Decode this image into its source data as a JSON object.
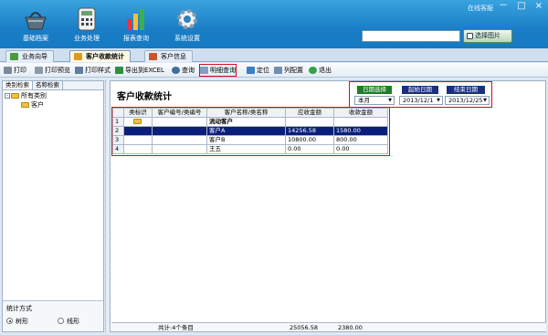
{
  "window": {
    "title": "在线客服",
    "min": "－",
    "max": "□",
    "close": "×"
  },
  "nav": [
    {
      "label": "基础档案",
      "icon": "basket-icon"
    },
    {
      "label": "业务处理",
      "icon": "calculator-icon"
    },
    {
      "label": "报表查询",
      "icon": "bar-chart-icon"
    },
    {
      "label": "系统设置",
      "icon": "gear-icon"
    }
  ],
  "search": {
    "value": "",
    "button": "选择图片"
  },
  "tabs": [
    {
      "label": "业务向导"
    },
    {
      "label": "客户收款统计"
    },
    {
      "label": "客户信息"
    }
  ],
  "toolbar": [
    "打印",
    "打印预览",
    "打印样式",
    "导出到EXCEL",
    "查询",
    "明细查询",
    "定位",
    "列配置",
    "退出"
  ],
  "left": {
    "tabs": [
      "类别检索",
      "名称检索"
    ],
    "tree": {
      "root": "所有类别",
      "child": "客户"
    },
    "stat": {
      "title": "统计方式",
      "opt1": "树形",
      "opt2": "线形"
    }
  },
  "page": {
    "title": "客户收款统计"
  },
  "filter": {
    "h1": "日期选择",
    "h2": "起始日期",
    "h3": "结束日期",
    "v1": "本月",
    "v2": "2013/12/1",
    "v3": "2013/12/25"
  },
  "table": {
    "headers": [
      "",
      "类标识",
      "客户编号/类编号",
      "客户名称/类名称",
      "应收金额",
      "收款金额"
    ],
    "rows": [
      [
        "1",
        "",
        "",
        "流动客户",
        "",
        ""
      ],
      [
        "2",
        "",
        "",
        "客户A",
        "14256.58",
        "1580.00"
      ],
      [
        "3",
        "",
        "",
        "客户B",
        "10800.00",
        "800.00"
      ],
      [
        "4",
        "",
        "",
        "王五",
        "0.00",
        "0.00"
      ]
    ]
  },
  "footer": {
    "count": "共计:4个条目",
    "total_due": "25056.58",
    "total_paid": "2380.00"
  }
}
